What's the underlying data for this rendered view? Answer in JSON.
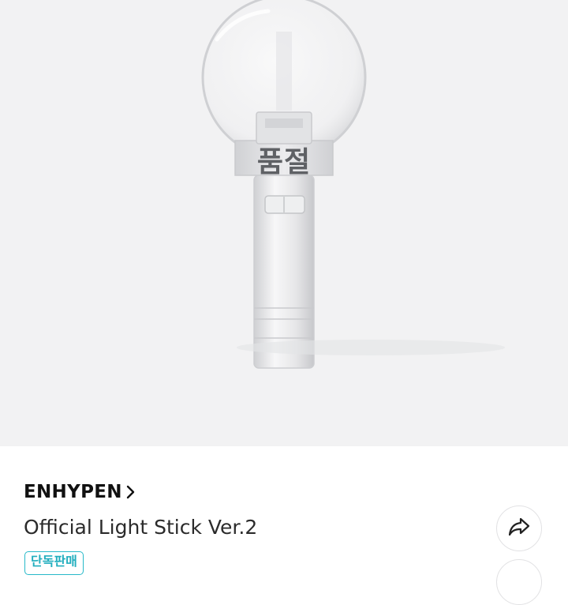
{
  "product": {
    "status_overlay": "품절",
    "brand": "ENHYPEN",
    "brand_chevron_icon": "chevron-right-icon",
    "title": "Official Light Stick Ver.2",
    "badge": "단독판매",
    "share_icon": "share-arrow-icon"
  },
  "colors": {
    "hero_background": "#f2f2f3",
    "badge_accent": "#27b9c9",
    "text_primary": "#111111"
  }
}
